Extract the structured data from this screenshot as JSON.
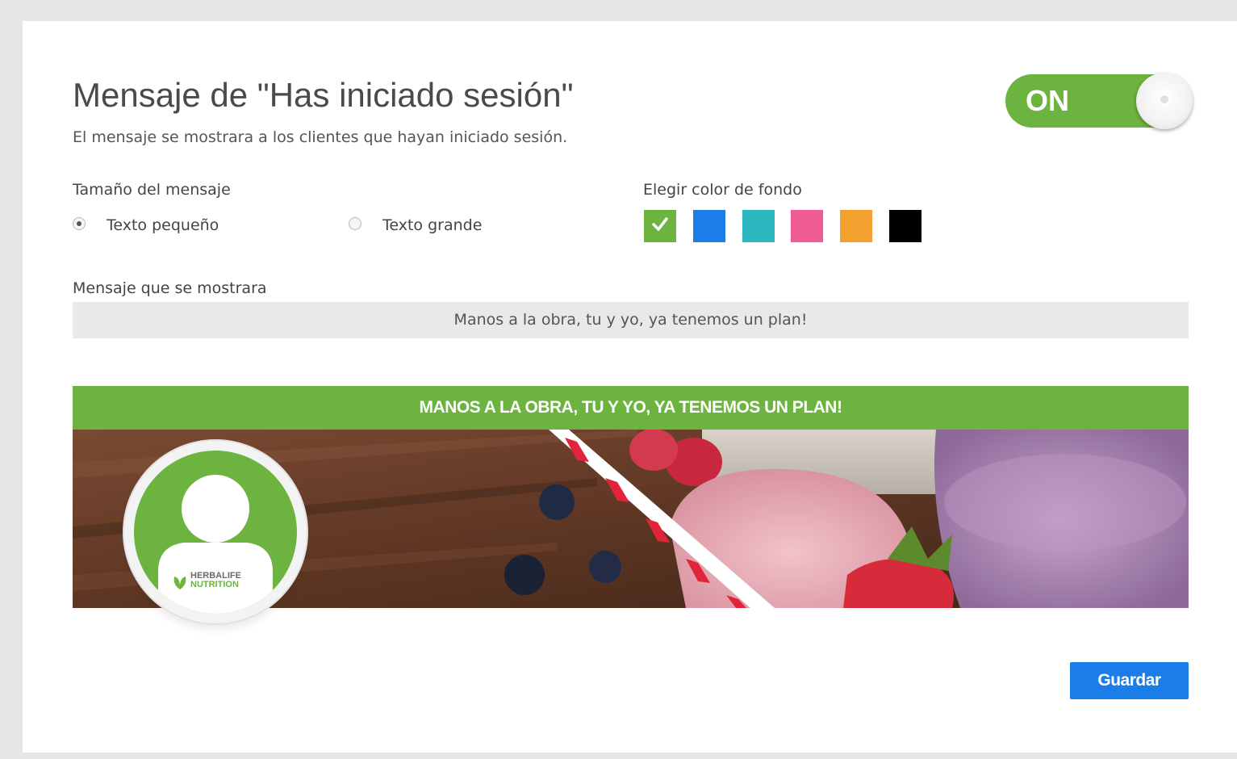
{
  "header": {
    "title": "Mensaje de \"Has iniciado sesión\"",
    "subtitle": "El mensaje se mostrara a los clientes que hayan iniciado sesión."
  },
  "toggle": {
    "label": "ON",
    "state": "on",
    "color": "#6cb33f"
  },
  "size_section": {
    "label": "Tamaño del mensaje",
    "options": [
      {
        "label": "Texto pequeño",
        "checked": true
      },
      {
        "label": "Texto grande",
        "checked": false
      }
    ]
  },
  "color_section": {
    "label": "Elegir color de fondo",
    "swatches": [
      {
        "color": "#6cb33f",
        "selected": true
      },
      {
        "color": "#1a7de8",
        "selected": false
      },
      {
        "color": "#2bb8c0",
        "selected": false
      },
      {
        "color": "#ef5b93",
        "selected": false
      },
      {
        "color": "#f4a12f",
        "selected": false
      },
      {
        "color": "#000000",
        "selected": false
      }
    ]
  },
  "message_section": {
    "label": "Mensaje que se mostrara",
    "value": "Manos a la obra, tu y yo, ya tenemos un plan!"
  },
  "preview": {
    "banner_text": "MANOS A LA OBRA, TU Y YO, YA TENEMOS UN PLAN!",
    "banner_color": "#6cb33f",
    "avatar_logo_line1": "HERBALIFE",
    "avatar_logo_line2": "NUTRITION"
  },
  "actions": {
    "save_label": "Guardar",
    "save_color": "#1a7de8"
  }
}
